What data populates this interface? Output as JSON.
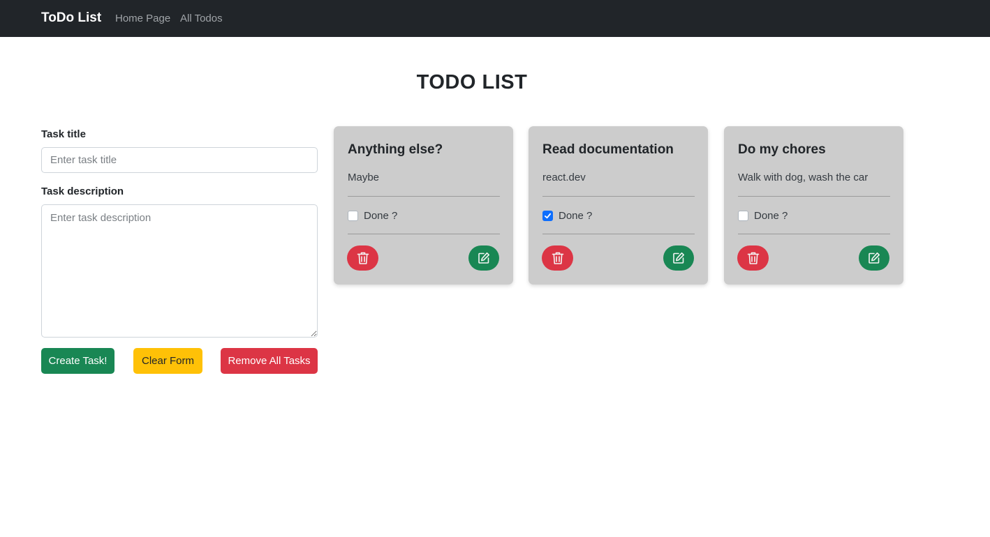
{
  "navbar": {
    "brand": "ToDo List",
    "links": [
      {
        "label": "Home Page"
      },
      {
        "label": "All Todos"
      }
    ]
  },
  "page_title": "TODO LIST",
  "form": {
    "title_label": "Task title",
    "title_placeholder": "Enter task title",
    "title_value": "",
    "desc_label": "Task description",
    "desc_placeholder": "Enter task description",
    "desc_value": "",
    "buttons": {
      "create": "Create Task!",
      "clear": "Clear Form",
      "remove_all": "Remove All Tasks"
    }
  },
  "tasks": [
    {
      "title": "Anything else?",
      "description": "Maybe",
      "done_label": "Done ?",
      "done": false
    },
    {
      "title": "Read documentation",
      "description": "react.dev",
      "done_label": "Done ?",
      "done": true
    },
    {
      "title": "Do my chores",
      "description": "Walk with dog, wash the car",
      "done_label": "Done ?",
      "done": false
    }
  ],
  "icons": {
    "delete": "trash-icon",
    "edit": "edit-icon"
  },
  "colors": {
    "navbar_bg": "#212529",
    "card_bg": "#cccccc",
    "success": "#198754",
    "warning": "#ffc107",
    "danger": "#dc3545",
    "checkbox_checked": "#0d6efd"
  }
}
